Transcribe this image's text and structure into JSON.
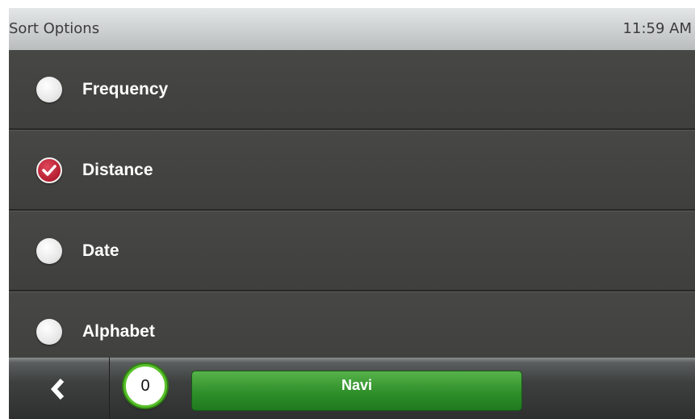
{
  "header": {
    "title": "Sort Options",
    "time": "11:59 AM"
  },
  "options": [
    {
      "label": "Frequency",
      "checked": false
    },
    {
      "label": "Distance",
      "checked": true
    },
    {
      "label": "Date",
      "checked": false
    },
    {
      "label": "Alphabet",
      "checked": false
    }
  ],
  "footer": {
    "back_icon": "chevron-left-icon",
    "badge_count": "0",
    "navi_label": "Navi"
  },
  "colors": {
    "accent_green": "#2f8f2a",
    "check_red": "#b31e30",
    "background": "#424240"
  }
}
